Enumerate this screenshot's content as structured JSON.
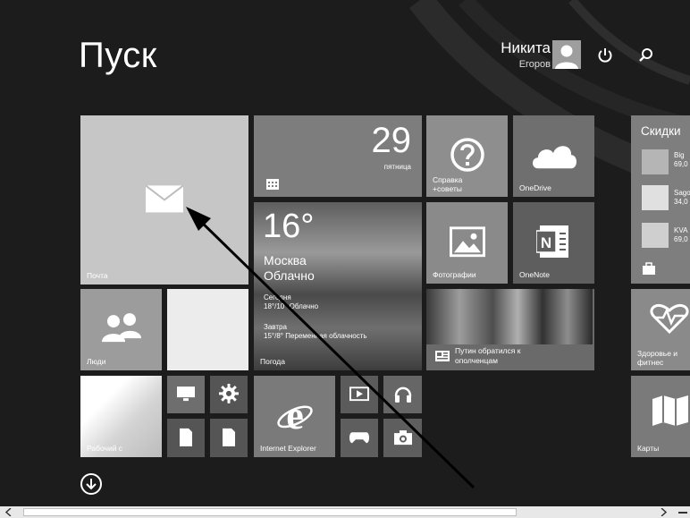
{
  "screen": {
    "title": "Пуск"
  },
  "user": {
    "first_name": "Никита",
    "last_name": "Егоров"
  },
  "tiles": {
    "mail": {
      "label": "Почта"
    },
    "calendar": {
      "day_number": "29",
      "weekday": "пятница"
    },
    "help": {
      "label_line1": "Справка",
      "label_line2": "+советы"
    },
    "onedrive": {
      "label": "OneDrive"
    },
    "weather": {
      "temp": "16°",
      "city": "Москва",
      "condition": "Облачно",
      "today_label": "Сегодня",
      "today_forecast": "18°/10° Облачно",
      "tomorrow_label": "Завтра",
      "tomorrow_forecast": "15°/8° Переменная облачность",
      "label": "Погода"
    },
    "photos": {
      "label": "Фотографии"
    },
    "onenote": {
      "label": "OneNote"
    },
    "people": {
      "label": "Люди"
    },
    "news": {
      "headline_line1": "Путин обратился к",
      "headline_line2": "ополченцам"
    },
    "desktop": {
      "label": "Рабочий с"
    },
    "ie": {
      "label": "Internet Explorer"
    },
    "store": {
      "title": "Скидки",
      "items": [
        {
          "name": "Big",
          "price": "69,0"
        },
        {
          "name": "Sago",
          "price": "34,0"
        },
        {
          "name": "KVA",
          "price": "69,0"
        }
      ]
    },
    "health": {
      "label_line1": "Здоровье и",
      "label_line2": "фитнес"
    },
    "maps": {
      "label": "Карты"
    }
  }
}
